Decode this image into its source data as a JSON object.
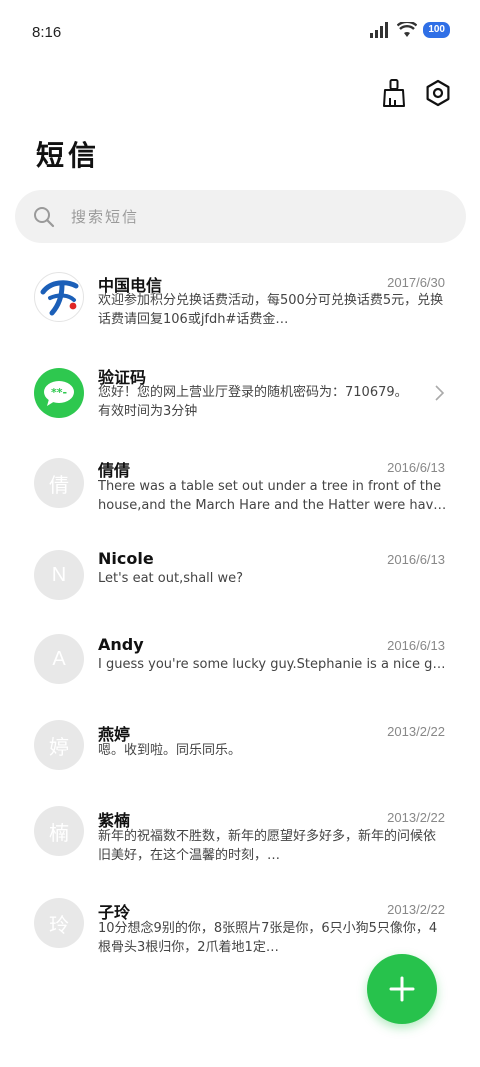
{
  "status_bar": {
    "time": "8:16",
    "battery": "100"
  },
  "header": {
    "title": "短信",
    "clean_icon": "broom-icon",
    "settings_icon": "settings-hex-icon"
  },
  "search": {
    "placeholder": "搜索短信"
  },
  "threads": [
    {
      "name": "中国电信",
      "date": "2017/6/30",
      "preview": "欢迎参加积分兑换话费活动，每500分可兑换话费5元，兑换话费请回复106或jfdh#话费金…",
      "avatar": ""
    },
    {
      "name": "验证码",
      "date": "",
      "preview": "您好！您的网上营业厅登录的随机密码为：710679。有效时间为3分钟",
      "avatar": "**-"
    },
    {
      "name": "倩倩",
      "date": "2016/6/13",
      "preview": "There was a table set out under a tree in front of the house,and the March Hare and the Hatter were hav…",
      "avatar": "倩"
    },
    {
      "name": "Nicole",
      "date": "2016/6/13",
      "preview": "Let's eat out,shall we?",
      "avatar": "N"
    },
    {
      "name": "Andy",
      "date": "2016/6/13",
      "preview": "I guess you're some lucky guy.Stephanie is a nice girl.",
      "avatar": "A"
    },
    {
      "name": "燕婷",
      "date": "2013/2/22",
      "preview": "嗯。收到啦。同乐同乐。",
      "avatar": "婷"
    },
    {
      "name": "紫楠",
      "date": "2013/2/22",
      "preview": "新年的祝福数不胜数，新年的愿望好多好多，新年的问候依旧美好，在这个温馨的时刻，…",
      "avatar": "楠"
    },
    {
      "name": "子玲",
      "date": "2013/2/22",
      "preview": "10分想念9别的你，8张照片7张是你，6只小狗5只像你，4根骨头3根归你，2爪着地1定…",
      "avatar": "玲"
    }
  ],
  "fab": {
    "icon": "plus-icon"
  },
  "colors": {
    "accent": "#27c24c",
    "battery": "#2f6fe6",
    "avatar_gray": "#e8e8e8"
  }
}
